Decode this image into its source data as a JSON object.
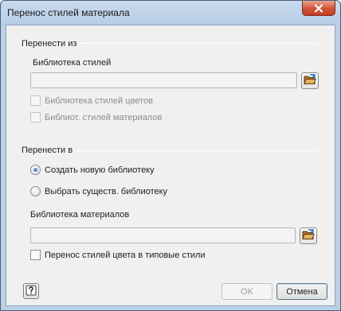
{
  "window": {
    "title": "Перенос стилей материала",
    "close_icon": "close-icon"
  },
  "transfer_from": {
    "group_label": "Перенести из",
    "style_library_label": "Библиотека стилей",
    "style_library_value": "",
    "browse_icon": "folder-browse-icon",
    "color_styles_checkbox": {
      "label": "Библиотека стилей цветов",
      "checked": false,
      "enabled": false
    },
    "material_styles_checkbox": {
      "label": "Библиот. стилей материалов",
      "checked": false,
      "enabled": false
    }
  },
  "transfer_to": {
    "group_label": "Перенести в",
    "radio_options": [
      {
        "label": "Создать новую библиотеку",
        "checked": true
      },
      {
        "label": "Выбрать существ. библиотеку",
        "checked": false
      }
    ],
    "material_library_label": "Библиотека материалов",
    "material_library_value": "",
    "browse_icon": "folder-browse-icon",
    "transfer_color_checkbox": {
      "label": "Перенос стилей цвета в типовые стили",
      "checked": false,
      "enabled": true
    }
  },
  "footer": {
    "help_icon": "help-icon",
    "ok_label": "OK",
    "cancel_label": "Отмена"
  },
  "colors": {
    "frame": "#bcd0e6",
    "client": "#f0f0f0",
    "close_button": "#c9472c"
  }
}
